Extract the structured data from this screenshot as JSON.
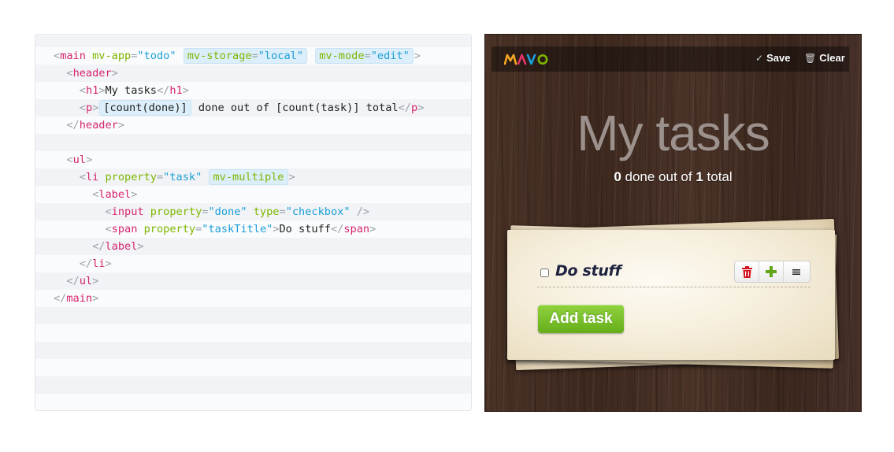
{
  "code": {
    "lines": [
      [
        {
          "t": "<",
          "c": "punc"
        },
        {
          "t": "main",
          "c": "tag"
        },
        {
          "t": " ",
          "c": "txt"
        },
        {
          "t": "mv-app",
          "c": "attr"
        },
        {
          "t": "=",
          "c": "punc"
        },
        {
          "t": "\"todo\"",
          "c": "val"
        },
        {
          "t": " ",
          "c": "txt"
        },
        {
          "hl": [
            {
              "t": "mv-storage",
              "c": "attr"
            },
            {
              "t": "=",
              "c": "punc"
            },
            {
              "t": "\"local\"",
              "c": "val"
            }
          ]
        },
        {
          "t": " ",
          "c": "txt"
        },
        {
          "hl": [
            {
              "t": "mv-mode",
              "c": "attr"
            },
            {
              "t": "=",
              "c": "punc"
            },
            {
              "t": "\"edit\"",
              "c": "val"
            }
          ]
        },
        {
          "t": ">",
          "c": "punc"
        }
      ],
      [
        {
          "t": "  ",
          "c": "txt"
        },
        {
          "t": "<",
          "c": "punc"
        },
        {
          "t": "header",
          "c": "tag"
        },
        {
          "t": ">",
          "c": "punc"
        }
      ],
      [
        {
          "t": "    ",
          "c": "txt"
        },
        {
          "t": "<",
          "c": "punc"
        },
        {
          "t": "h1",
          "c": "tag"
        },
        {
          "t": ">",
          "c": "punc"
        },
        {
          "t": "My tasks",
          "c": "txt"
        },
        {
          "t": "</",
          "c": "punc"
        },
        {
          "t": "h1",
          "c": "tag"
        },
        {
          "t": ">",
          "c": "punc"
        }
      ],
      [
        {
          "t": "    ",
          "c": "txt"
        },
        {
          "t": "<",
          "c": "punc"
        },
        {
          "t": "p",
          "c": "tag"
        },
        {
          "t": ">",
          "c": "punc"
        },
        {
          "hl": [
            {
              "t": "[count(done)]",
              "c": "txt"
            }
          ]
        },
        {
          "t": " done out of [count(task)] total",
          "c": "txt"
        },
        {
          "t": "</",
          "c": "punc"
        },
        {
          "t": "p",
          "c": "tag"
        },
        {
          "t": ">",
          "c": "punc"
        }
      ],
      [
        {
          "t": "  ",
          "c": "txt"
        },
        {
          "t": "</",
          "c": "punc"
        },
        {
          "t": "header",
          "c": "tag"
        },
        {
          "t": ">",
          "c": "punc"
        }
      ],
      [],
      [
        {
          "t": "  ",
          "c": "txt"
        },
        {
          "t": "<",
          "c": "punc"
        },
        {
          "t": "ul",
          "c": "tag"
        },
        {
          "t": ">",
          "c": "punc"
        }
      ],
      [
        {
          "t": "    ",
          "c": "txt"
        },
        {
          "t": "<",
          "c": "punc"
        },
        {
          "t": "li",
          "c": "tag"
        },
        {
          "t": " ",
          "c": "txt"
        },
        {
          "t": "property",
          "c": "attr"
        },
        {
          "t": "=",
          "c": "punc"
        },
        {
          "t": "\"task\"",
          "c": "val"
        },
        {
          "t": " ",
          "c": "txt"
        },
        {
          "hl": [
            {
              "t": "mv-multiple",
              "c": "attr"
            }
          ]
        },
        {
          "t": ">",
          "c": "punc"
        }
      ],
      [
        {
          "t": "      ",
          "c": "txt"
        },
        {
          "t": "<",
          "c": "punc"
        },
        {
          "t": "label",
          "c": "tag"
        },
        {
          "t": ">",
          "c": "punc"
        }
      ],
      [
        {
          "t": "        ",
          "c": "txt"
        },
        {
          "t": "<",
          "c": "punc"
        },
        {
          "t": "input",
          "c": "tag"
        },
        {
          "t": " ",
          "c": "txt"
        },
        {
          "t": "property",
          "c": "attr"
        },
        {
          "t": "=",
          "c": "punc"
        },
        {
          "t": "\"done\"",
          "c": "val"
        },
        {
          "t": " ",
          "c": "txt"
        },
        {
          "t": "type",
          "c": "attr"
        },
        {
          "t": "=",
          "c": "punc"
        },
        {
          "t": "\"checkbox\"",
          "c": "val"
        },
        {
          "t": " />",
          "c": "punc"
        }
      ],
      [
        {
          "t": "        ",
          "c": "txt"
        },
        {
          "t": "<",
          "c": "punc"
        },
        {
          "t": "span",
          "c": "tag"
        },
        {
          "t": " ",
          "c": "txt"
        },
        {
          "t": "property",
          "c": "attr"
        },
        {
          "t": "=",
          "c": "punc"
        },
        {
          "t": "\"taskTitle\"",
          "c": "val"
        },
        {
          "t": ">",
          "c": "punc"
        },
        {
          "t": "Do stuff",
          "c": "txt"
        },
        {
          "t": "</",
          "c": "punc"
        },
        {
          "t": "span",
          "c": "tag"
        },
        {
          "t": ">",
          "c": "punc"
        }
      ],
      [
        {
          "t": "      ",
          "c": "txt"
        },
        {
          "t": "</",
          "c": "punc"
        },
        {
          "t": "label",
          "c": "tag"
        },
        {
          "t": ">",
          "c": "punc"
        }
      ],
      [
        {
          "t": "    ",
          "c": "txt"
        },
        {
          "t": "</",
          "c": "punc"
        },
        {
          "t": "li",
          "c": "tag"
        },
        {
          "t": ">",
          "c": "punc"
        }
      ],
      [
        {
          "t": "  ",
          "c": "txt"
        },
        {
          "t": "</",
          "c": "punc"
        },
        {
          "t": "ul",
          "c": "tag"
        },
        {
          "t": ">",
          "c": "punc"
        }
      ],
      [
        {
          "t": "</",
          "c": "punc"
        },
        {
          "t": "main",
          "c": "tag"
        },
        {
          "t": ">",
          "c": "punc"
        }
      ]
    ]
  },
  "app": {
    "logo": {
      "letters": [
        "M",
        "A",
        "V",
        "O"
      ],
      "colors": [
        "#f5a623",
        "#e8336c",
        "#1aa3e0",
        "#7db600"
      ]
    },
    "toolbar": {
      "save_label": "Save",
      "save_icon": "check-icon",
      "clear_label": "Clear",
      "clear_icon": "trash-icon"
    },
    "title": "My tasks",
    "summary": {
      "done": "0",
      "middle": " done out of ",
      "total": "1",
      "suffix": " total"
    },
    "tasks": [
      {
        "title": "Do stuff",
        "done": false
      }
    ],
    "task_tools": {
      "delete_icon": "trash-icon",
      "add_icon": "plus-icon",
      "drag_icon": "menu-icon"
    },
    "add_button_label": "Add task",
    "colors": {
      "add_green": "#76bd25",
      "delete_red": "#d4111e",
      "plus_green": "#63a51a"
    }
  }
}
